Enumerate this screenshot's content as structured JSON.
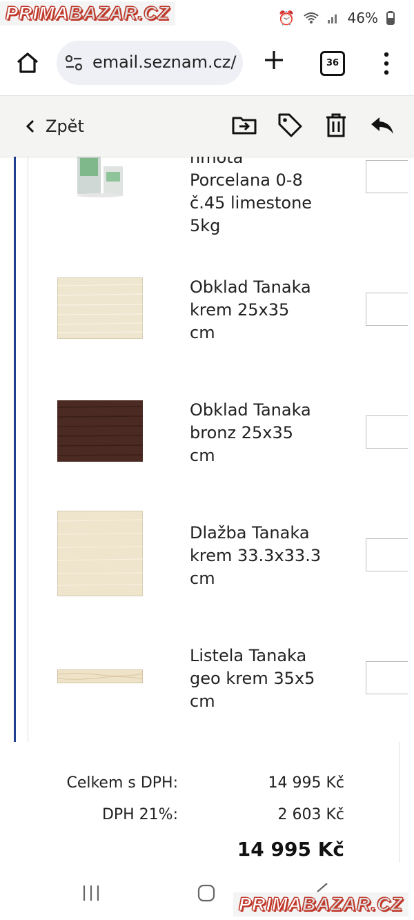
{
  "watermark": {
    "part1": "PRIMA",
    "part2": "BAZAR.CZ"
  },
  "status": {
    "battery": "46%"
  },
  "browser": {
    "url": "email.seznam.cz/",
    "tab_count": "36"
  },
  "toolbar": {
    "back_label": "Zpět"
  },
  "products": [
    {
      "name_lines": [
        "hmota",
        "Porcelana 0-8",
        "č.45 limestone",
        "5kg"
      ]
    },
    {
      "name_lines": [
        "Obklad Tanaka",
        "krem 25x35",
        "cm"
      ]
    },
    {
      "name_lines": [
        "Obklad Tanaka",
        "bronz 25x35",
        "cm"
      ]
    },
    {
      "name_lines": [
        "Dlažba Tanaka",
        "krem 33.3x33.3",
        "cm"
      ]
    },
    {
      "name_lines": [
        "Listela Tanaka",
        "geo krem 35x5",
        "cm"
      ]
    }
  ],
  "totals": {
    "total_label": "Celkem s DPH:",
    "total_value": "14 995 Kč",
    "vat_label": "DPH 21%:",
    "vat_value": "2 603 Kč",
    "grand_total": "14 995 Kč"
  },
  "icons": {
    "home": "home-icon",
    "site_settings": "site-settings-icon",
    "new_tab": "plus-icon",
    "tabs": "tabs-count-icon",
    "menu": "more-vert-icon",
    "back": "chevron-left-icon",
    "move": "move-to-folder-icon",
    "label": "tag-icon",
    "delete": "trash-icon",
    "reply": "reply-icon",
    "recent_apps": "recent-apps-icon",
    "home_nav": "home-nav-icon",
    "back_nav": "back-nav-icon"
  },
  "colors": {
    "accent_line": "#1f3f8f",
    "watermark_red": "#c0392b",
    "tile_cream": "#efe6d0",
    "tile_bronze": "#4a2a22"
  }
}
